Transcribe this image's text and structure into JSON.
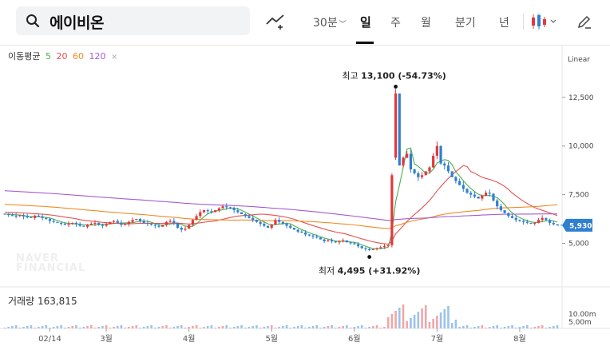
{
  "search": {
    "query": "에이비온"
  },
  "toolbar": {
    "interval": "30분",
    "periods": [
      "일",
      "주",
      "월",
      "분기",
      "년"
    ],
    "active_period": "일"
  },
  "scale": "Linear",
  "legend": {
    "label": "이동평균",
    "ma": [
      "5",
      "20",
      "60",
      "120"
    ]
  },
  "annotations": {
    "high_label": "최고",
    "high_value": "13,100",
    "high_pct": "(-54.73%)",
    "low_label": "최저",
    "low_value": "4,495",
    "low_pct": "(+31.92%)"
  },
  "volume": {
    "label": "거래량",
    "value": "163,815",
    "ticks": [
      "10.00m",
      "5.00m"
    ]
  },
  "current_price": "5,930",
  "watermark": [
    "NAVER",
    "FINANCIAL"
  ],
  "colors": {
    "up": "#e0393e",
    "down": "#2f7fd1",
    "ma5": "#4caf50",
    "ma20": "#e55050",
    "ma60": "#f08a24",
    "ma120": "#a45bd1",
    "price_tag": "#2f7fd1"
  },
  "chart_data": {
    "type": "candlestick",
    "y_ticks": [
      "12,500",
      "10,000",
      "7,500",
      "5,000"
    ],
    "x_ticks": [
      "02/14",
      "3월",
      "4월",
      "5월",
      "6월",
      "7월",
      "8월"
    ],
    "ylim": [
      3500,
      15000
    ],
    "closes": [
      6500,
      6450,
      6420,
      6400,
      6450,
      6380,
      6350,
      6300,
      6420,
      6380,
      6300,
      6250,
      6150,
      6100,
      6050,
      6000,
      5950,
      6000,
      6050,
      5980,
      5900,
      5850,
      5950,
      6000,
      6050,
      5950,
      5900,
      5980,
      6100,
      6150,
      6050,
      5950,
      6000,
      6100,
      6200,
      6250,
      6150,
      6050,
      6000,
      5950,
      5900,
      5850,
      5950,
      6100,
      6150,
      6050,
      5800,
      5700,
      5750,
      5950,
      6200,
      6400,
      6600,
      6700,
      6650,
      6600,
      6700,
      6800,
      6900,
      6850,
      6800,
      6700,
      6600,
      6500,
      6400,
      6300,
      6200,
      6100,
      6000,
      5900,
      5800,
      5950,
      6200,
      6100,
      6000,
      5900,
      5800,
      5700,
      5600,
      5550,
      5450,
      5400,
      5350,
      5300,
      5200,
      5100,
      5150,
      5100,
      5050,
      5100,
      5150,
      5050,
      5000,
      4950,
      4850,
      4750,
      4700,
      4650,
      4700,
      4750,
      4800,
      4850,
      4900,
      8500,
      12700,
      9000,
      9400,
      9600,
      8800,
      8600,
      8400,
      8500,
      8700,
      8900,
      9500,
      10000,
      9100,
      9000,
      8700,
      8400,
      8200,
      8000,
      7800,
      7600,
      7500,
      7400,
      7300,
      7450,
      7600,
      7550,
      7200,
      6900,
      6700,
      6550,
      6400,
      6300,
      6200,
      6150,
      6100,
      6050,
      6000,
      6050,
      6200,
      6300,
      6200,
      6050,
      5980,
      5930
    ]
  }
}
